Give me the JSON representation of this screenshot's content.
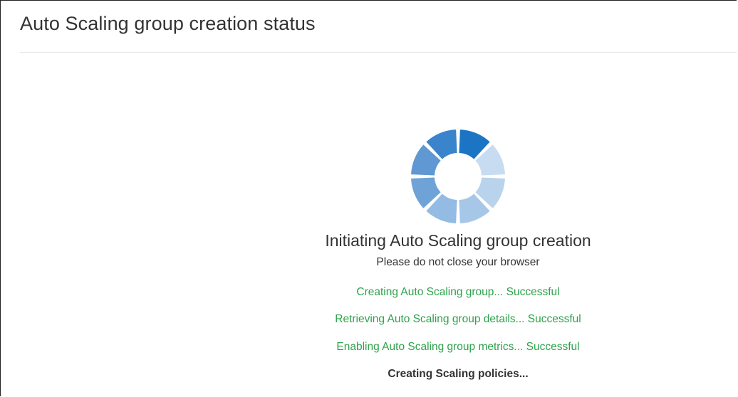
{
  "page": {
    "title": "Auto Scaling group creation status"
  },
  "status": {
    "heading": "Initiating Auto Scaling group creation",
    "subheading": "Please do not close your browser"
  },
  "spinner": {
    "icon": "loading-spinner-icon",
    "segment_colors": [
      "#1b75c4",
      "#c7dcf0",
      "#bad3ec",
      "#a6c7e8",
      "#93bbe3",
      "#6fa3d8",
      "#5f98d3",
      "#3a84cb"
    ]
  },
  "steps": [
    {
      "text": "Creating Auto Scaling group... Successful",
      "state": "success"
    },
    {
      "text": "Retrieving Auto Scaling group details... Successful",
      "state": "success"
    },
    {
      "text": "Enabling Auto Scaling group metrics... Successful",
      "state": "success"
    },
    {
      "text": "Creating Scaling policies...",
      "state": "in-progress"
    }
  ],
  "colors": {
    "success": "#2ea24b",
    "text": "#333333"
  }
}
